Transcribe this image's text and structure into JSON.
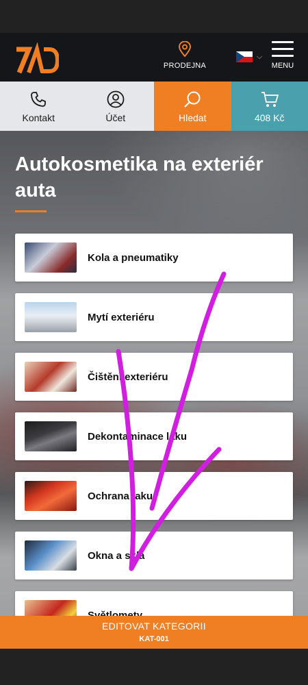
{
  "header": {
    "logo_icon": "ad-logo",
    "store_label": "PRODEJNA",
    "store_icon": "map-pin-icon",
    "language_flag": "czech-flag",
    "menu_label": "MENU"
  },
  "toolbar": {
    "contact_label": "Kontakt",
    "account_label": "Účet",
    "search_label": "Hledat",
    "cart_label": "408 Kč"
  },
  "page": {
    "title": "Autokosmetika na exteriér auta"
  },
  "categories": [
    {
      "label": "Kola a pneumatiky"
    },
    {
      "label": "Mytí exteriéru"
    },
    {
      "label": "Čištění exteriéru"
    },
    {
      "label": "Dekontaminace laku"
    },
    {
      "label": "Ochrana laku"
    },
    {
      "label": "Okna a skla"
    },
    {
      "label": "Světlomety"
    }
  ],
  "edit_bar": {
    "title": "EDITOVAT KATEGORII",
    "code": "KAT-001"
  },
  "colors": {
    "accent": "#f07f23",
    "teal": "#4aa0ac",
    "header_bg": "#14161a",
    "annotation": "#d11fe0"
  }
}
